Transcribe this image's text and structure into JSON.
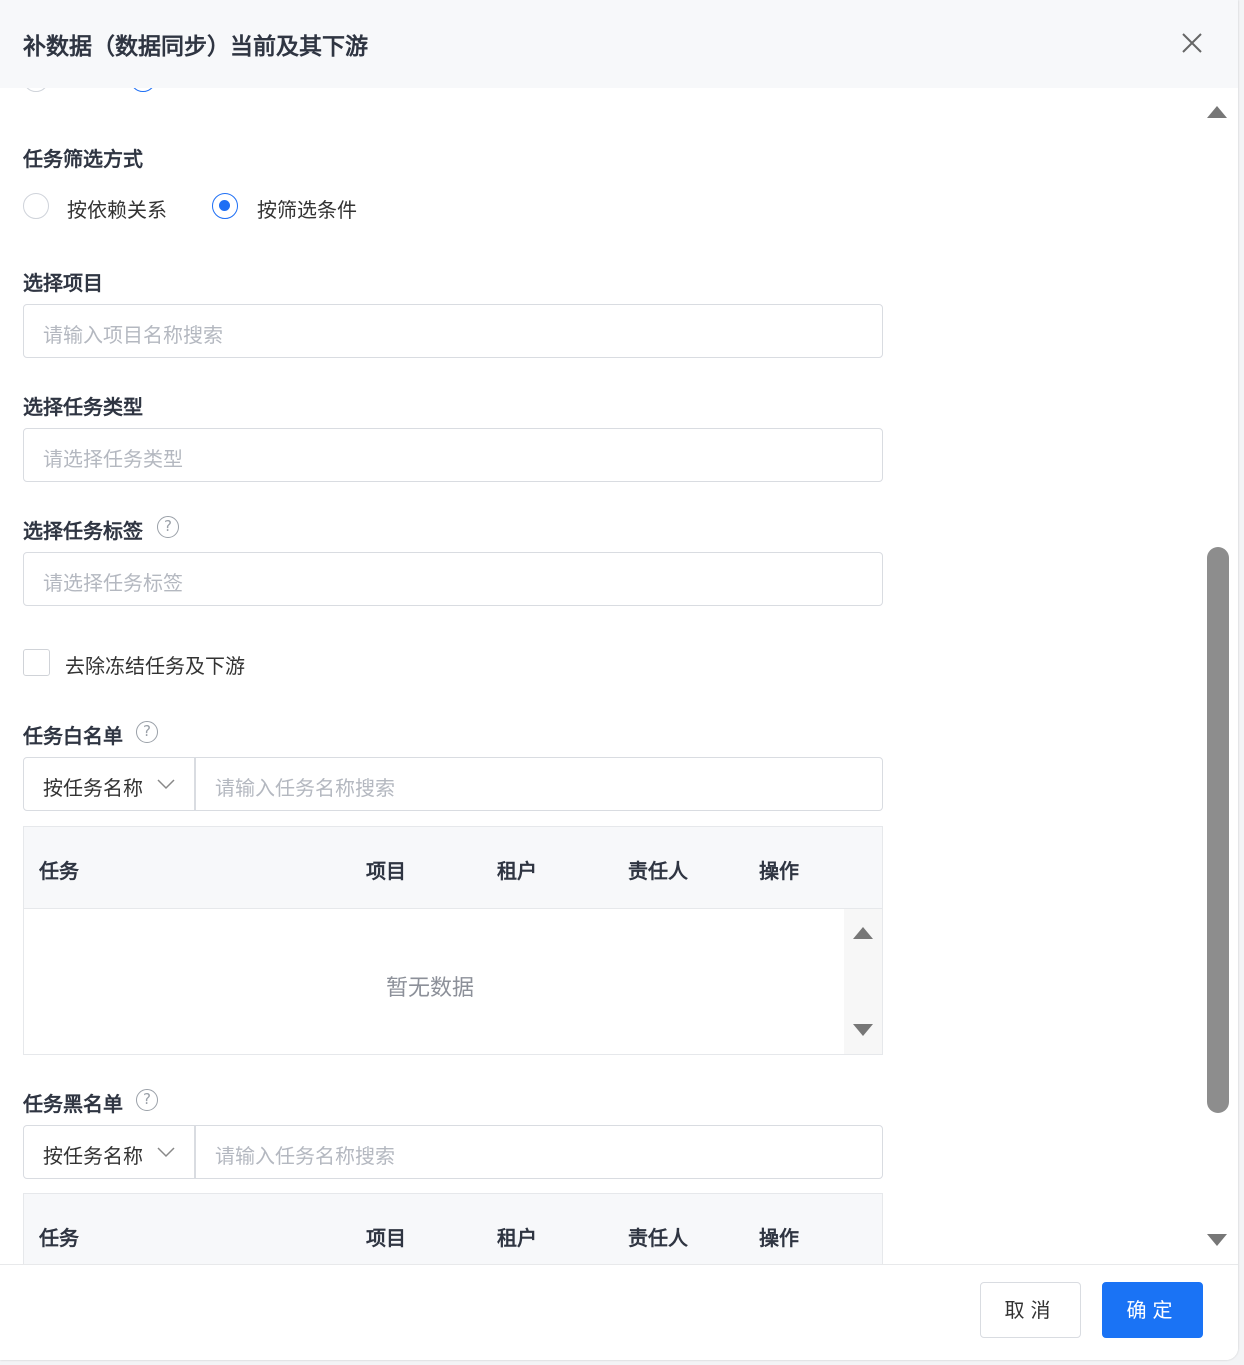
{
  "dialog": {
    "title": "补数据（数据同步）当前及其下游",
    "close_icon": "close-icon"
  },
  "filter_mode": {
    "label": "任务筛选方式",
    "options": [
      "按依赖关系",
      "按筛选条件"
    ],
    "selected": "按筛选条件"
  },
  "project": {
    "label": "选择项目",
    "placeholder": "请输入项目名称搜索"
  },
  "task_type": {
    "label": "选择任务类型",
    "placeholder": "请选择任务类型"
  },
  "task_tag": {
    "label": "选择任务标签",
    "placeholder": "请选择任务标签",
    "help_icon": "question-circle-icon"
  },
  "exclude_frozen": {
    "label": "去除冻结任务及下游",
    "checked": false
  },
  "whitelist": {
    "label": "任务白名单",
    "select_value": "按任务名称",
    "search_placeholder": "请输入任务名称搜索",
    "columns": [
      "任务",
      "项目",
      "租户",
      "责任人",
      "操作"
    ],
    "empty_text": "暂无数据"
  },
  "blacklist": {
    "label": "任务黑名单",
    "select_value": "按任务名称",
    "search_placeholder": "请输入任务名称搜索",
    "columns": [
      "任务",
      "项目",
      "租户",
      "责任人",
      "操作"
    ]
  },
  "footer": {
    "cancel_label": "取消",
    "ok_label": "确定"
  },
  "colors": {
    "primary": "#1a73f5",
    "radio_selected": "#1e6ff5"
  }
}
